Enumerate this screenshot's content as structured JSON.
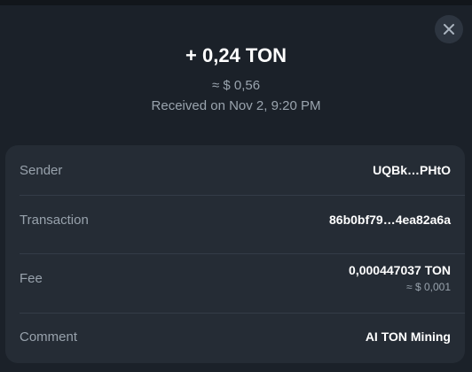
{
  "header": {
    "amount": "+ 0,24 TON",
    "fiat_amount": "≈ $ 0,56",
    "received": "Received on Nov 2, 9:20 PM"
  },
  "details": {
    "sender": {
      "label": "Sender",
      "value": "UQBk…PHtO"
    },
    "transaction": {
      "label": "Transaction",
      "value": "86b0bf79…4ea82a6a"
    },
    "fee": {
      "label": "Fee",
      "value": "0,000447037 TON",
      "fiat": "≈ $ 0,001"
    },
    "comment": {
      "label": "Comment",
      "value": "AI TON Mining"
    }
  },
  "colors": {
    "background": "#1b2129",
    "card": "#252c35",
    "text_primary": "#ffffff",
    "text_secondary": "#98a2ac"
  },
  "icons": {
    "close": "close-icon"
  }
}
